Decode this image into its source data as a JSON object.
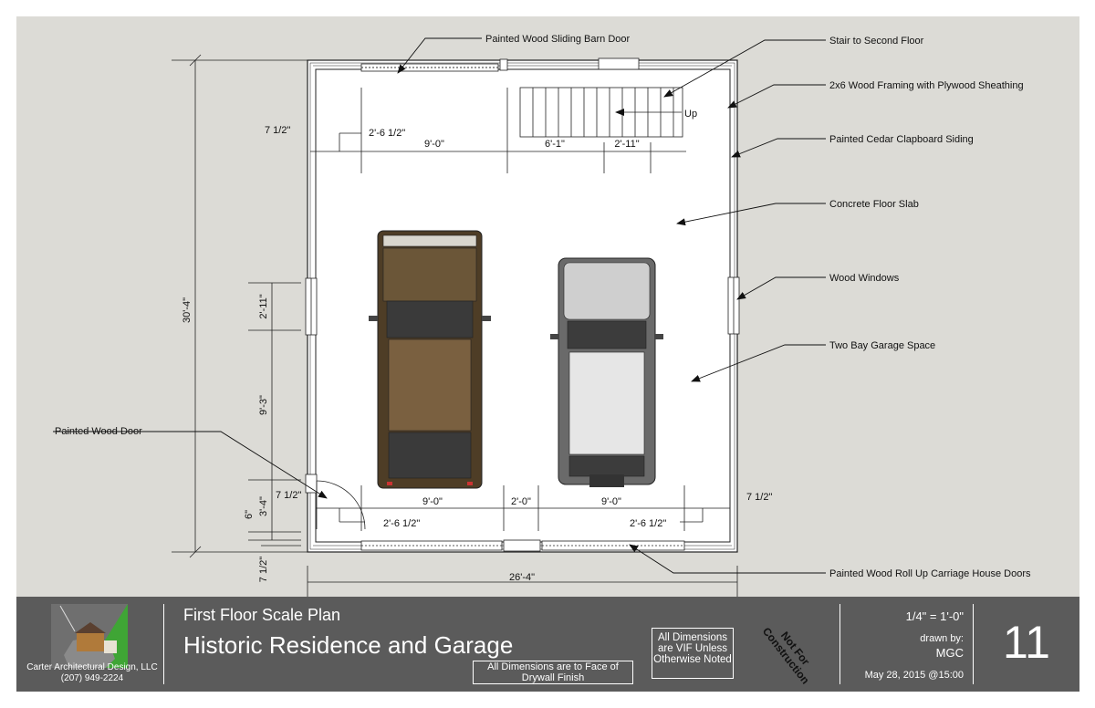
{
  "callouts": {
    "barn_door": "Painted Wood Sliding Barn Door",
    "stair": "Stair to Second Floor",
    "framing": "2x6 Wood Framing with Plywood Sheathing",
    "siding": "Painted Cedar Clapboard Siding",
    "slab": "Concrete Floor Slab",
    "windows": "Wood Windows",
    "garage": "Two Bay Garage Space",
    "door": "Painted Wood Door",
    "carriage_doors": "Painted Wood Roll Up Carriage House Doors"
  },
  "stair_label": "Up",
  "dimensions": {
    "overall_height": "30'-4\"",
    "overall_width": "26'-4\"",
    "top_left_inset": "7 1/2\"",
    "top_left_offset": "2'-6 1/2\"",
    "top_bay": "9'-0\"",
    "stair_run": "6'-1\"",
    "stair_width": "2'-11\"",
    "left_window_width": "2'-11\"",
    "left_wall_mid": "9'-3\"",
    "left_lower": "3'-4\"",
    "left_6": "6\"",
    "left_bottom_inset": "7 1/2\"",
    "bottom_left_inset": "7 1/2\"",
    "bottom_bay_1": "9'-0\"",
    "bottom_gap": "2'-0\"",
    "bottom_bay_2": "9'-0\"",
    "bottom_right_inset": "7 1/2\"",
    "bottom_left_offset": "2'-6 1/2\"",
    "bottom_right_offset": "2'-6 1/2\""
  },
  "title_block": {
    "company": "Carter Architectural Design, LLC",
    "phone": "(207) 949-2224",
    "sheet_subtitle": "First Floor Scale Plan",
    "project_title": "Historic Residence and Garage",
    "drywall_note": "All Dimensions are to Face of Drywall Finish",
    "vif_note": "All Dimensions are VIF Unless Otherwise Noted",
    "not_for_construction": "Not For Construction",
    "scale": "1/4\" = 1'-0\"",
    "drawn_by_label": "drawn by:",
    "drawn_by": "MGC",
    "date": "May 28, 2015 @15:00",
    "sheet_number": "11"
  }
}
